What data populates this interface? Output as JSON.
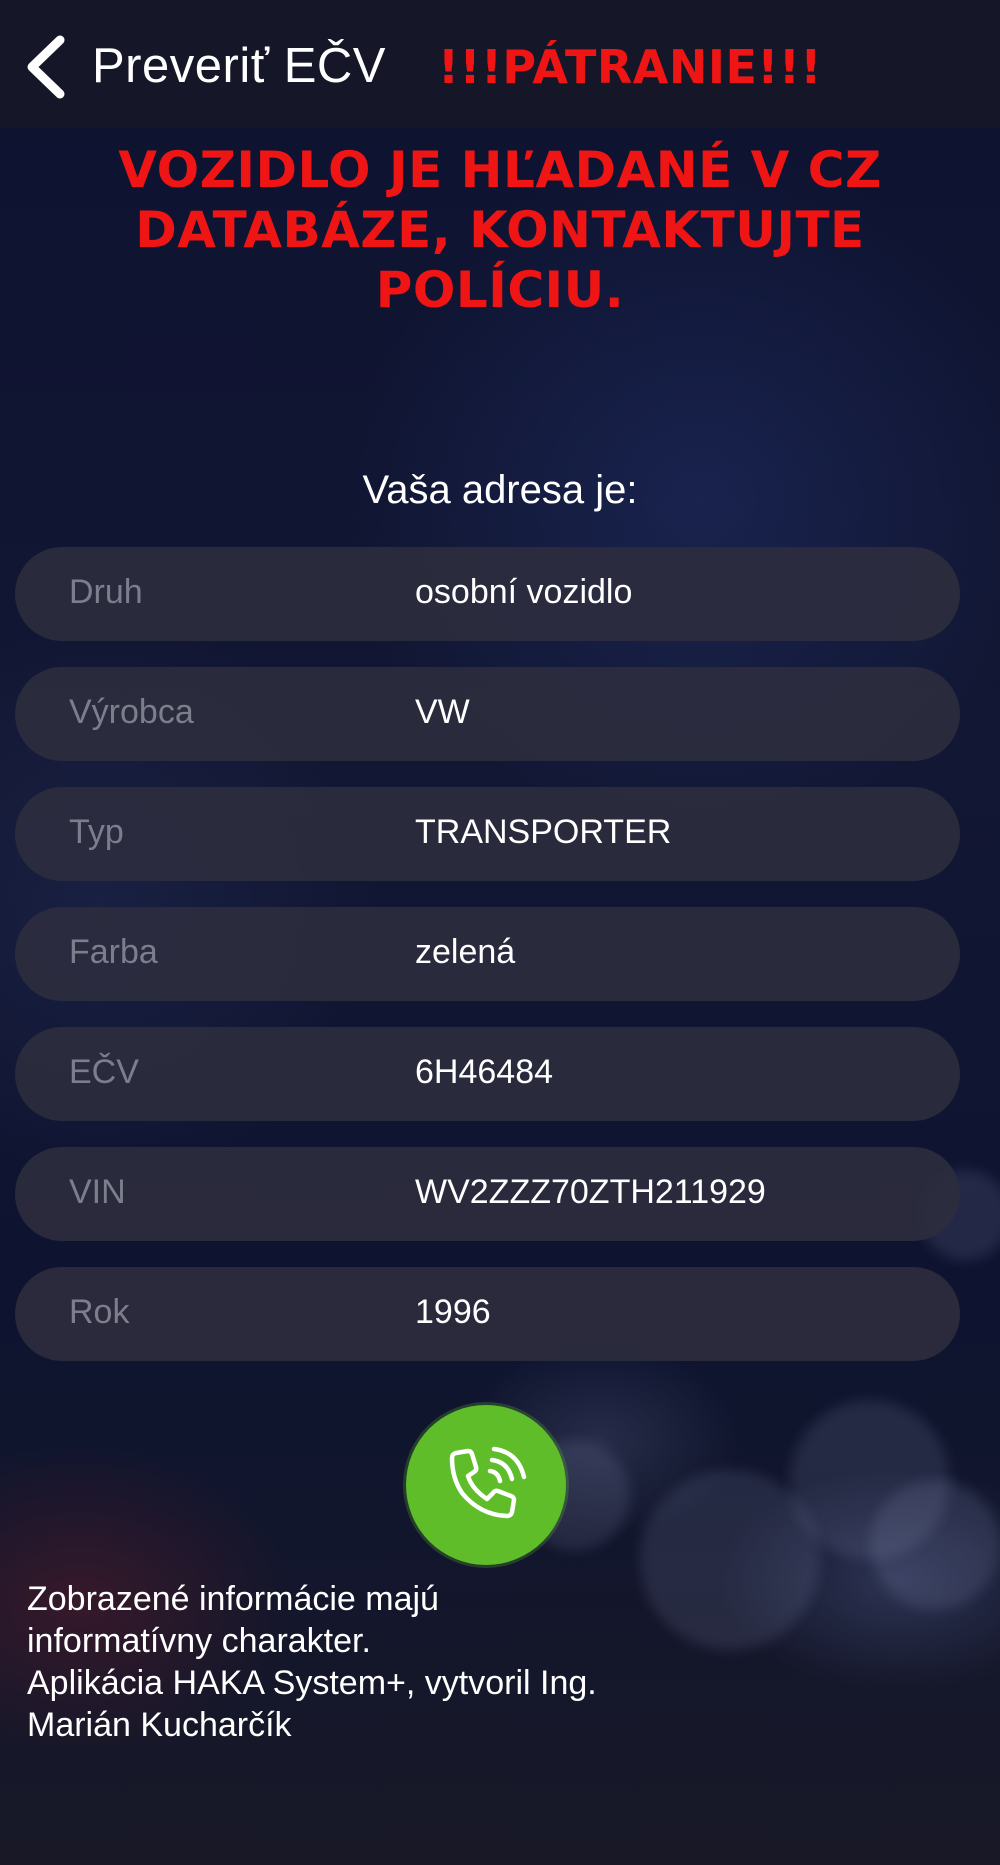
{
  "header": {
    "title": "Preveriť EČV",
    "alert_tag": "!!!PÁTRANIE!!!"
  },
  "warning": {
    "lines": [
      "VOZIDLO JE HĽADANÉ V CZ",
      "DATABÁZE, KONTAKTUJTE",
      "POLÍCIU."
    ]
  },
  "subtitle": "Vaša adresa je:",
  "details": [
    {
      "label": "Druh",
      "value": "osobní vozidlo"
    },
    {
      "label": "Výrobca",
      "value": "VW"
    },
    {
      "label": "Typ",
      "value": "TRANSPORTER"
    },
    {
      "label": "Farba",
      "value": "zelená"
    },
    {
      "label": "EČV",
      "value": "6H46484"
    },
    {
      "label": "VIN",
      "value": "WV2ZZZ70ZTH211929"
    },
    {
      "label": "Rok",
      "value": "1996"
    }
  ],
  "call_button": {
    "icon": "phone-call-icon",
    "color": "#5fbd2a"
  },
  "footer": {
    "lines": [
      "Zobrazené informácie majú",
      "informatívny charakter.",
      "Aplikácia HAKA System+, vytvoril Ing.",
      "Marián Kucharčík"
    ]
  },
  "colors": {
    "alert": "#f01515",
    "row_background": "#2c2d3e",
    "label": "#7d7e8c"
  }
}
